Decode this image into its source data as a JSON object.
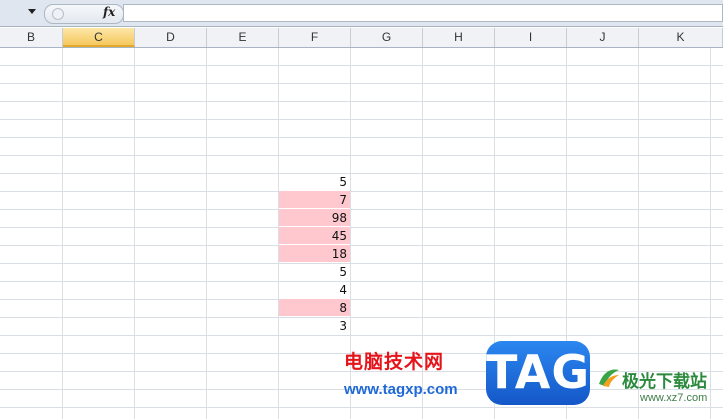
{
  "formula_bar": {
    "fx_label": "fx",
    "formula_value": ""
  },
  "columns": [
    "B",
    "C",
    "D",
    "E",
    "F",
    "G",
    "H",
    "I",
    "J",
    "K"
  ],
  "active_column": "C",
  "column_f_values": [
    {
      "value": "5",
      "highlighted": false
    },
    {
      "value": "7",
      "highlighted": true
    },
    {
      "value": "98",
      "highlighted": true
    },
    {
      "value": "45",
      "highlighted": true
    },
    {
      "value": "18",
      "highlighted": true
    },
    {
      "value": "5",
      "highlighted": false
    },
    {
      "value": "4",
      "highlighted": false
    },
    {
      "value": "8",
      "highlighted": true
    },
    {
      "value": "3",
      "highlighted": false
    }
  ],
  "colors": {
    "highlight_fill": "#ffc7ce",
    "active_header": "#f6c85e",
    "gridline": "#dadfe6"
  },
  "watermarks": {
    "site_cn": "电脑技术网",
    "site_url": "www.tagxp.com",
    "tag_logo": "TAG",
    "site2_cn": "极光下载站",
    "site2_url": "www.xz7.com"
  }
}
